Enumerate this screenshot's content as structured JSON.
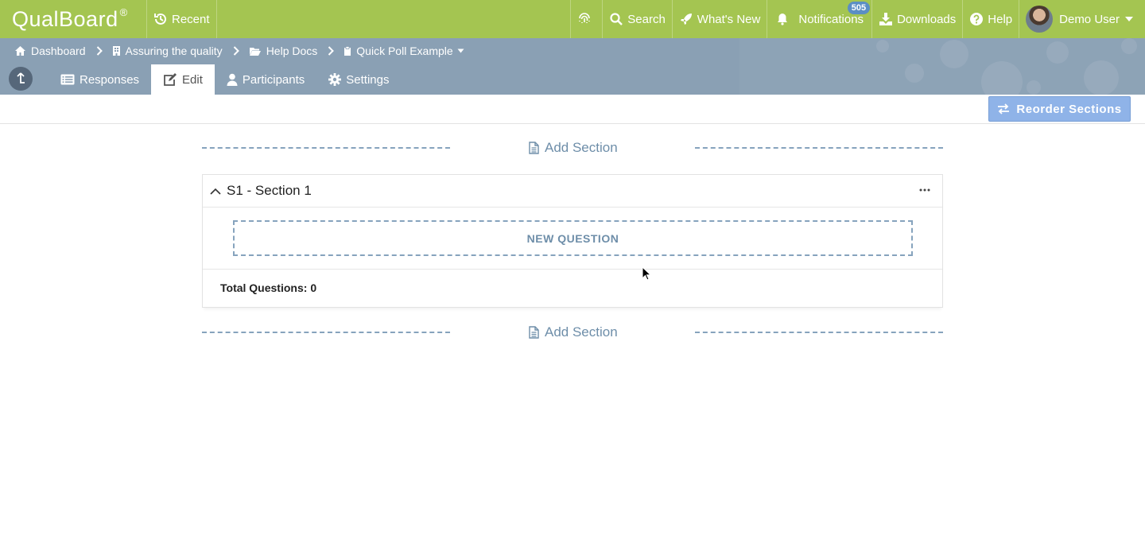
{
  "topbar": {
    "logo_text": "QualBoard",
    "logo_reg": "®",
    "recent_label": "Recent",
    "search_label": "Search",
    "whats_new_label": "What's New",
    "notifications_label": "Notifications",
    "notifications_count": "505",
    "downloads_label": "Downloads",
    "help_label": "Help",
    "user_name": "Demo User"
  },
  "breadcrumb": {
    "dashboard": "Dashboard",
    "project": "Assuring the quality",
    "folder": "Help Docs",
    "activity": "Quick Poll Example"
  },
  "tabs": {
    "responses": "Responses",
    "edit": "Edit",
    "participants": "Participants",
    "settings": "Settings"
  },
  "toolbar": {
    "reorder_label": "Reorder Sections"
  },
  "main": {
    "add_section_label": "Add Section",
    "section": {
      "title": "S1 - Section 1",
      "new_question_label": "NEW QUESTION",
      "total_label": "Total Questions:",
      "total_value": "0"
    }
  },
  "colors": {
    "topbar_bg": "#a4c551",
    "subheader_bg": "#8aa0b4",
    "accent_link": "#6e8ea9",
    "reorder_button": "#8fb3e8",
    "badge": "#5b8ec4"
  }
}
